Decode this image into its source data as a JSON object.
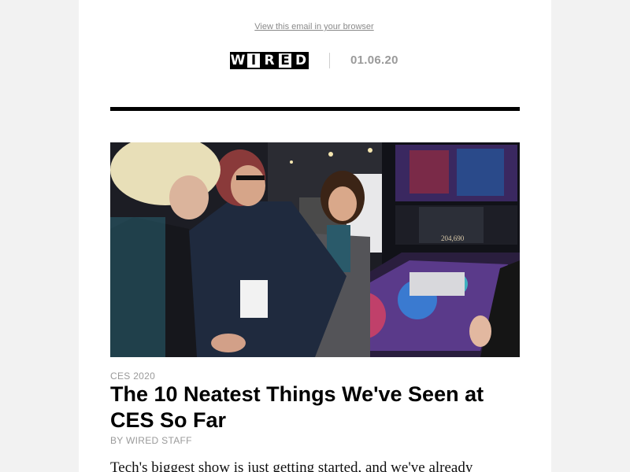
{
  "header": {
    "view_in_browser": "View this email in your browser",
    "logo_text": "WIRED",
    "date": "01.06.20"
  },
  "article": {
    "image_icon": "photo-hero-image",
    "image_screen_number": "204,690",
    "kicker": "CES 2020",
    "headline": "The 10 Neatest Things We've Seen at CES So Far",
    "byline": "BY WIRED STAFF",
    "dek": "Tech's biggest show is just getting started, and we've already"
  },
  "colors": {
    "background": "#f2f2f2",
    "card": "#ffffff",
    "text": "#000000",
    "muted": "#9a9a9a"
  }
}
